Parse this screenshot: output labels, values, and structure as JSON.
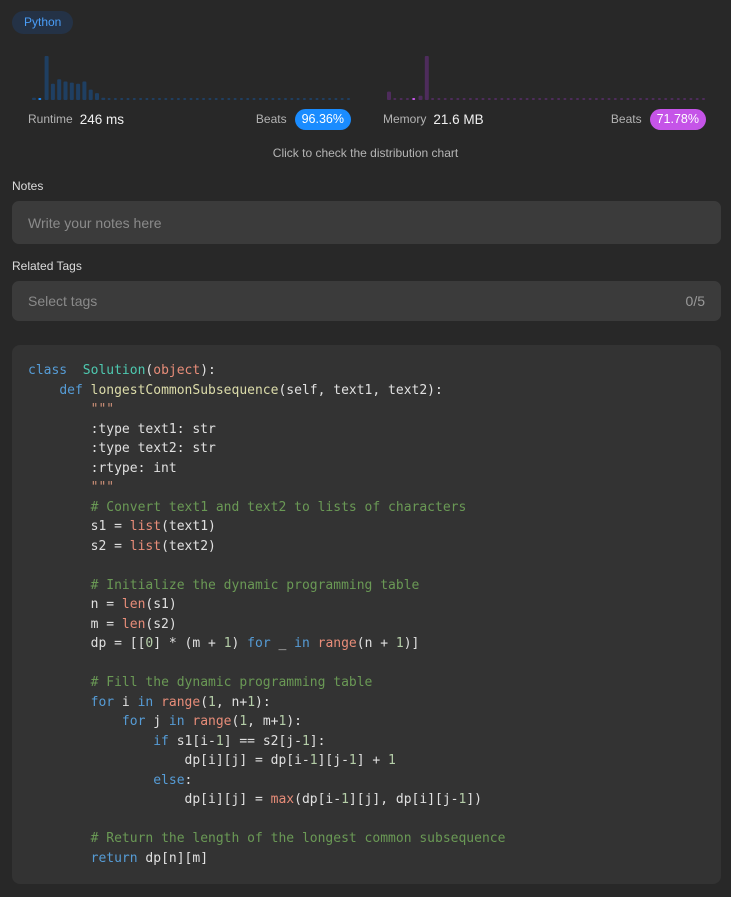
{
  "language_badge": "Python",
  "runtime": {
    "label": "Runtime",
    "value": "246 ms",
    "beats_label": "Beats",
    "beats_value": "96.36%",
    "color": "#1a8cff",
    "distribution": [
      2,
      1,
      38,
      14,
      18,
      16,
      15,
      14,
      16,
      9,
      6,
      2,
      1,
      1,
      1,
      1,
      1,
      1,
      1,
      1,
      1,
      1,
      1,
      1,
      1,
      1,
      1,
      1,
      1,
      1,
      1,
      1,
      1,
      1,
      1,
      1,
      1,
      1,
      1,
      1,
      1,
      1,
      1,
      1,
      1,
      1,
      1,
      1,
      1,
      1,
      1
    ],
    "highlight_index": 1
  },
  "memory": {
    "label": "Memory",
    "value": "21.6 MB",
    "beats_label": "Beats",
    "beats_value": "71.78%",
    "color": "#c554e8",
    "distribution": [
      8,
      1,
      1,
      1,
      1,
      4,
      42,
      1,
      1,
      1,
      1,
      1,
      1,
      1,
      1,
      1,
      1,
      1,
      1,
      1,
      1,
      1,
      1,
      1,
      1,
      1,
      1,
      1,
      1,
      1,
      1,
      1,
      1,
      1,
      1,
      1,
      1,
      1,
      1,
      1,
      1,
      1,
      1,
      1,
      1,
      1,
      1,
      1,
      1,
      1,
      1
    ],
    "highlight_index": 4
  },
  "distribution_link": "Click to check the distribution chart",
  "notes": {
    "label": "Notes",
    "placeholder": "Write your notes here",
    "value": ""
  },
  "tags": {
    "label": "Related Tags",
    "placeholder": "Select tags",
    "count": "0/5"
  },
  "code_lines": [
    [
      [
        "kw",
        "class"
      ],
      [
        "",
        "  "
      ],
      [
        "cls",
        "Solution"
      ],
      [
        "",
        "("
      ],
      [
        "bi",
        "object"
      ],
      [
        "",
        "):"
      ]
    ],
    [
      [
        "",
        "    "
      ],
      [
        "kw",
        "def"
      ],
      [
        "",
        " "
      ],
      [
        "fn",
        "longestCommonSubsequence"
      ],
      [
        "",
        "(self, text1, text2):"
      ]
    ],
    [
      [
        "",
        "        "
      ],
      [
        "st",
        "\"\"\""
      ]
    ],
    [
      [
        "",
        "        :type text1: str"
      ]
    ],
    [
      [
        "",
        "        :type text2: str"
      ]
    ],
    [
      [
        "",
        "        :rtype: int"
      ]
    ],
    [
      [
        "",
        "        "
      ],
      [
        "st",
        "\"\"\""
      ]
    ],
    [
      [
        "",
        "        "
      ],
      [
        "cm",
        "# Convert text1 and text2 to lists of characters"
      ]
    ],
    [
      [
        "",
        "        s1 = "
      ],
      [
        "bi",
        "list"
      ],
      [
        "",
        "(text1)"
      ]
    ],
    [
      [
        "",
        "        s2 = "
      ],
      [
        "bi",
        "list"
      ],
      [
        "",
        "(text2)"
      ]
    ],
    [
      [
        "",
        ""
      ]
    ],
    [
      [
        "",
        "        "
      ],
      [
        "cm",
        "# Initialize the dynamic programming table"
      ]
    ],
    [
      [
        "",
        "        n = "
      ],
      [
        "bi",
        "len"
      ],
      [
        "",
        "(s1)"
      ]
    ],
    [
      [
        "",
        "        m = "
      ],
      [
        "bi",
        "len"
      ],
      [
        "",
        "(s2)"
      ]
    ],
    [
      [
        "",
        "        dp = [["
      ],
      [
        "num",
        "0"
      ],
      [
        "",
        "] * (m + "
      ],
      [
        "num",
        "1"
      ],
      [
        "",
        ") "
      ],
      [
        "kw",
        "for"
      ],
      [
        "",
        " _ "
      ],
      [
        "kw",
        "in"
      ],
      [
        "",
        " "
      ],
      [
        "bi",
        "range"
      ],
      [
        "",
        "(n + "
      ],
      [
        "num",
        "1"
      ],
      [
        "",
        ")]"
      ]
    ],
    [
      [
        "",
        ""
      ]
    ],
    [
      [
        "",
        "        "
      ],
      [
        "cm",
        "# Fill the dynamic programming table"
      ]
    ],
    [
      [
        "",
        "        "
      ],
      [
        "kw",
        "for"
      ],
      [
        "",
        " i "
      ],
      [
        "kw",
        "in"
      ],
      [
        "",
        " "
      ],
      [
        "bi",
        "range"
      ],
      [
        "",
        "("
      ],
      [
        "num",
        "1"
      ],
      [
        "",
        ", n+"
      ],
      [
        "num",
        "1"
      ],
      [
        "",
        "):"
      ]
    ],
    [
      [
        "",
        "            "
      ],
      [
        "kw",
        "for"
      ],
      [
        "",
        " j "
      ],
      [
        "kw",
        "in"
      ],
      [
        "",
        " "
      ],
      [
        "bi",
        "range"
      ],
      [
        "",
        "("
      ],
      [
        "num",
        "1"
      ],
      [
        "",
        ", m+"
      ],
      [
        "num",
        "1"
      ],
      [
        "",
        "):"
      ]
    ],
    [
      [
        "",
        "                "
      ],
      [
        "kw",
        "if"
      ],
      [
        "",
        " s1[i-"
      ],
      [
        "num",
        "1"
      ],
      [
        "",
        "] == s2[j-"
      ],
      [
        "num",
        "1"
      ],
      [
        "",
        "]:"
      ]
    ],
    [
      [
        "",
        "                    dp[i][j] = dp[i-"
      ],
      [
        "num",
        "1"
      ],
      [
        "",
        "][j-"
      ],
      [
        "num",
        "1"
      ],
      [
        "",
        "] + "
      ],
      [
        "num",
        "1"
      ]
    ],
    [
      [
        "",
        "                "
      ],
      [
        "kw",
        "else"
      ],
      [
        "",
        ":"
      ]
    ],
    [
      [
        "",
        "                    dp[i][j] = "
      ],
      [
        "bi",
        "max"
      ],
      [
        "",
        "(dp[i-"
      ],
      [
        "num",
        "1"
      ],
      [
        "",
        "][j], dp[i][j-"
      ],
      [
        "num",
        "1"
      ],
      [
        "",
        "])"
      ]
    ],
    [
      [
        "",
        ""
      ]
    ],
    [
      [
        "",
        "        "
      ],
      [
        "cm",
        "# Return the length of the longest common subsequence"
      ]
    ],
    [
      [
        "",
        "        "
      ],
      [
        "kw",
        "return"
      ],
      [
        "",
        " dp[n][m]"
      ]
    ]
  ]
}
